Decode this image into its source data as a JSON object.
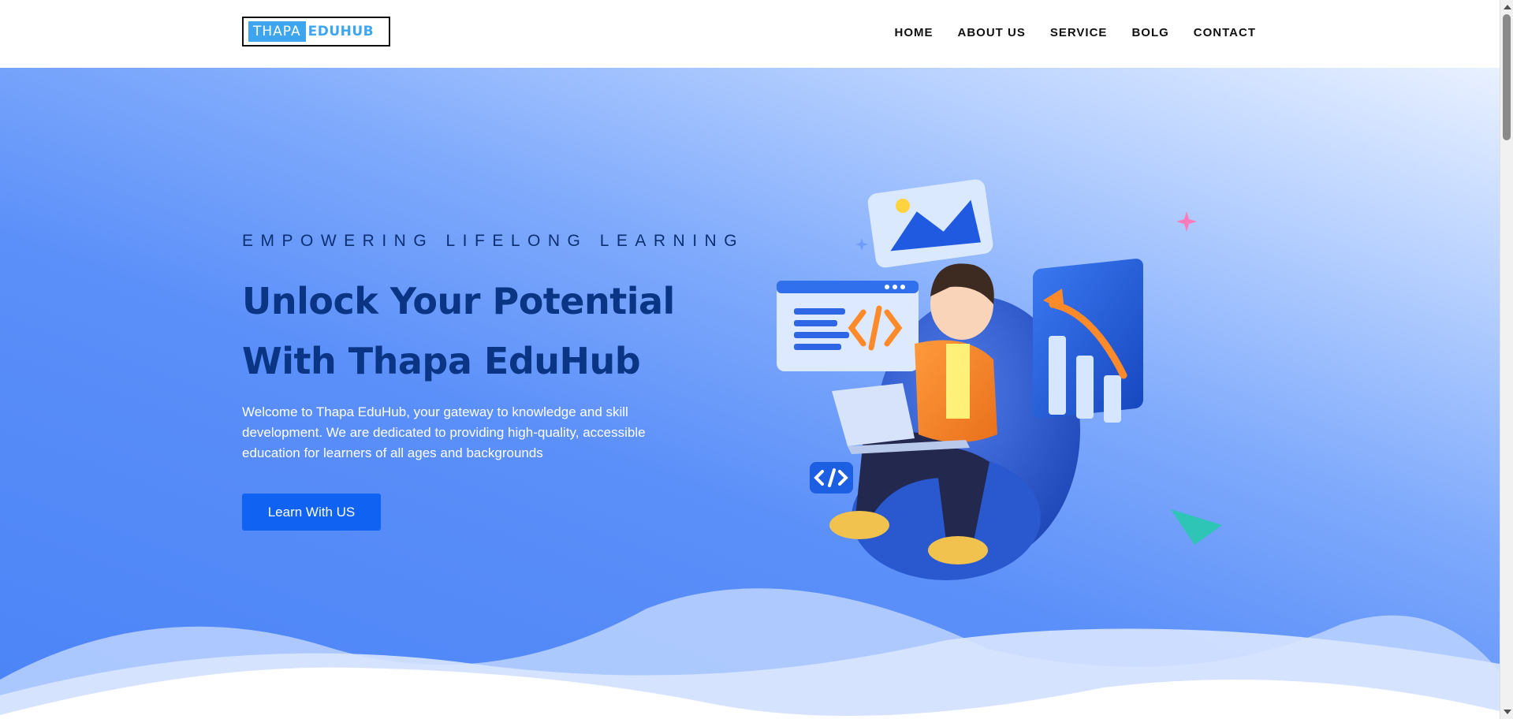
{
  "header": {
    "logo": {
      "part1": "THAPA",
      "part2": "EDUHUB"
    },
    "nav": [
      {
        "label": "HOME"
      },
      {
        "label": "ABOUT US"
      },
      {
        "label": "SERVICE"
      },
      {
        "label": "BOLG"
      },
      {
        "label": "CONTACT"
      }
    ]
  },
  "hero": {
    "eyebrow": "EMPOWERING LIFELONG LEARNING",
    "headline_line1": "Unlock Your Potential",
    "headline_line2": "With Thapa EduHub",
    "intro": "Welcome to Thapa EduHub, your gateway to knowledge and skill development. We are dedicated to providing high-quality, accessible education for learners of all ages and backgrounds",
    "cta_label": "Learn With US"
  },
  "colors": {
    "brand_blue": "#3ea6ee",
    "headline": "#0a3584",
    "cta": "#0f62f2"
  },
  "icons": [
    "code-window-icon",
    "image-card-icon",
    "bar-chart-icon",
    "code-chip-icon",
    "paper-plane-icon",
    "sparkle-icon"
  ]
}
